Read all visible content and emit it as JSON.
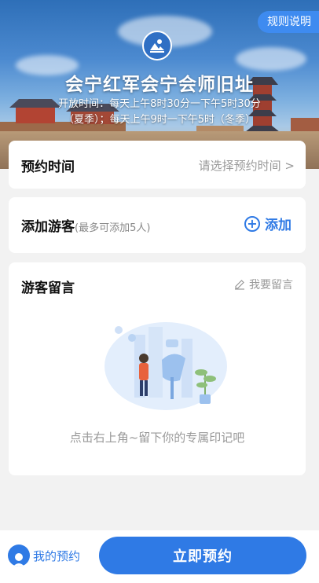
{
  "header": {
    "rules_label": "规则说明",
    "title": "会宁红军会宁会师旧址",
    "hours_line1": "开放时间：每天上午8时30分一下午5时30分",
    "hours_line2": "（夏季）；每天上午9时一下午5时（冬季）"
  },
  "booking_time": {
    "label": "预约时间",
    "placeholder": "请选择预约时间 >"
  },
  "visitors": {
    "label": "添加游客",
    "hint": "(最多可添加5人)",
    "add_label": "添加"
  },
  "messages": {
    "label": "游客留言",
    "leave_label": "我要留言",
    "empty_text": "点击右上角~留下你的专属印记吧"
  },
  "footer": {
    "my_booking_label": "我的预约",
    "book_now_label": "立即预约"
  },
  "colors": {
    "accent": "#2f7ae5",
    "rules_bg": "#3e8bf0"
  }
}
